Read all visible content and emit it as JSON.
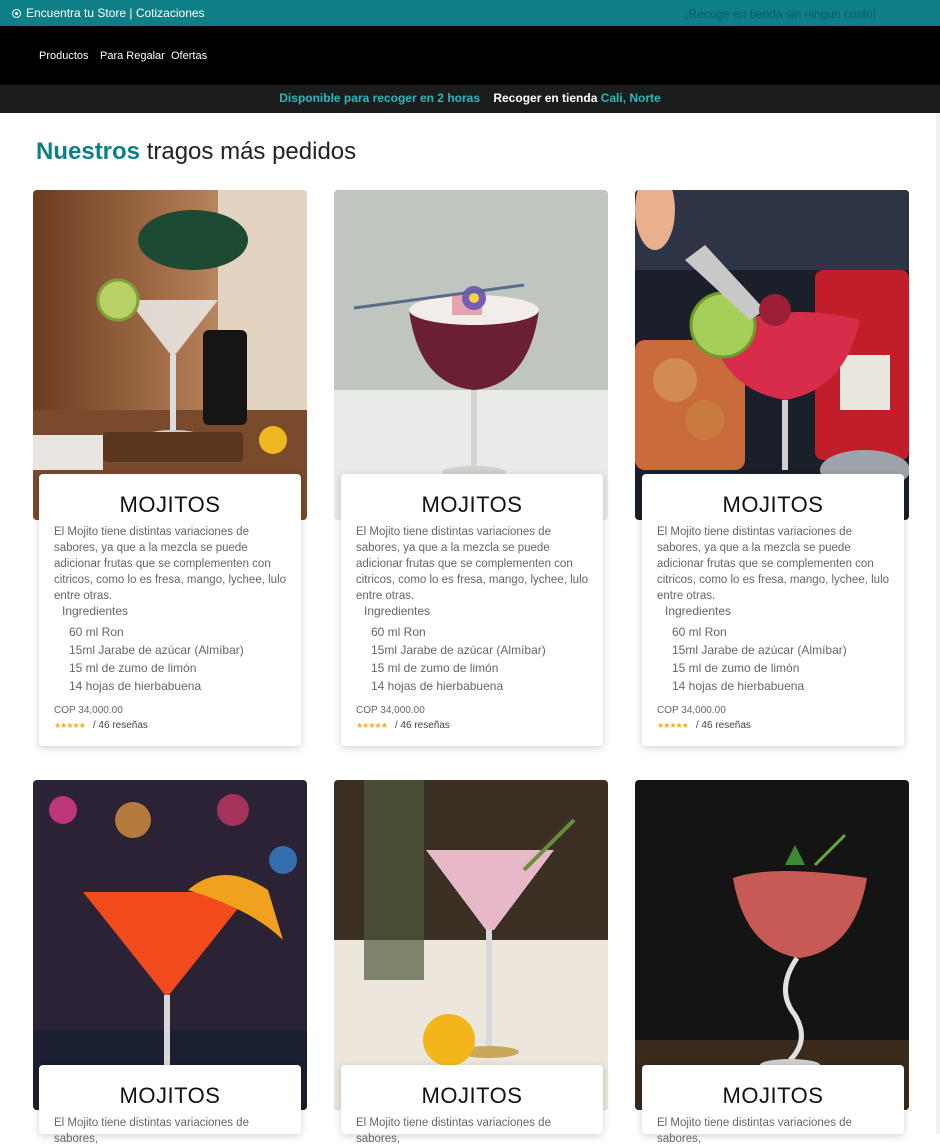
{
  "topbar": {
    "left_text": "Encuentra tu Store | Cotizaciones",
    "right_text": "¡Recoge en tienda sin ningún costo!",
    "icon": "location-pin-icon"
  },
  "nav": {
    "items": [
      "Productos",
      "Para Regalar",
      "Ofertas"
    ]
  },
  "pickup": {
    "available": "Disponible para recoger en 2 horas",
    "pickup_label": "Recoger en tienda",
    "store": "Cali, Norte"
  },
  "section": {
    "title_strong": "Nuestros",
    "title_rest": "tragos más pedidos"
  },
  "cards": [
    {
      "title": "MOJITOS",
      "description": "El Mojito tiene distintas variaciones de sabores, ya que a la mezcla se puede adicionar frutas que se complementen con citricos, como lo es fresa, mango, lychee, lulo entre otras.",
      "ingredients_label": "Ingredientes",
      "ingredients": [
        "60 ml Ron",
        "15ml Jarabe de azúcar (Almíbar)",
        "15 ml de zumo de limón",
        "14 hojas de hierbabuena"
      ],
      "price": "COP 34,000.00",
      "stars": "★★★★★",
      "reviews": "/ 46 reseñas",
      "rating": 4.5
    },
    {
      "title": "MOJITOS",
      "description": "El Mojito tiene distintas variaciones de sabores, ya que a la mezcla se puede adicionar frutas que se complementen con citricos, como lo es fresa, mango, lychee, lulo entre otras.",
      "ingredients_label": "Ingredientes",
      "ingredients": [
        "60 ml Ron",
        "15ml Jarabe de azúcar (Almíbar)",
        "15 ml de zumo de limón",
        "14 hojas de hierbabuena"
      ],
      "price": "COP 34,000.00",
      "stars": "★★★★★",
      "reviews": "/ 46 reseñas",
      "rating": 4.5
    },
    {
      "title": "MOJITOS",
      "description": "El Mojito tiene distintas variaciones de sabores, ya que a la mezcla se puede adicionar frutas que se complementen con citricos, como lo es fresa, mango, lychee, lulo entre otras.",
      "ingredients_label": "Ingredientes",
      "ingredients": [
        "60 ml Ron",
        "15ml Jarabe de azúcar (Almíbar)",
        "15 ml de zumo de limón",
        "14 hojas de hierbabuena"
      ],
      "price": "COP 34,000.00",
      "stars": "★★★★★",
      "reviews": "/ 46 reseñas",
      "rating": 4.5
    },
    {
      "title": "MOJITOS",
      "description": "El Mojito tiene distintas variaciones de sabores,"
    },
    {
      "title": "MOJITOS",
      "description": "El Mojito tiene distintas variaciones de sabores,"
    },
    {
      "title": "MOJITOS",
      "description": "El Mojito tiene distintas variaciones de sabores,"
    }
  ],
  "colors": {
    "accent": "#0e7f86",
    "accent_light": "#26b9bf",
    "star": "#f2b01e"
  }
}
